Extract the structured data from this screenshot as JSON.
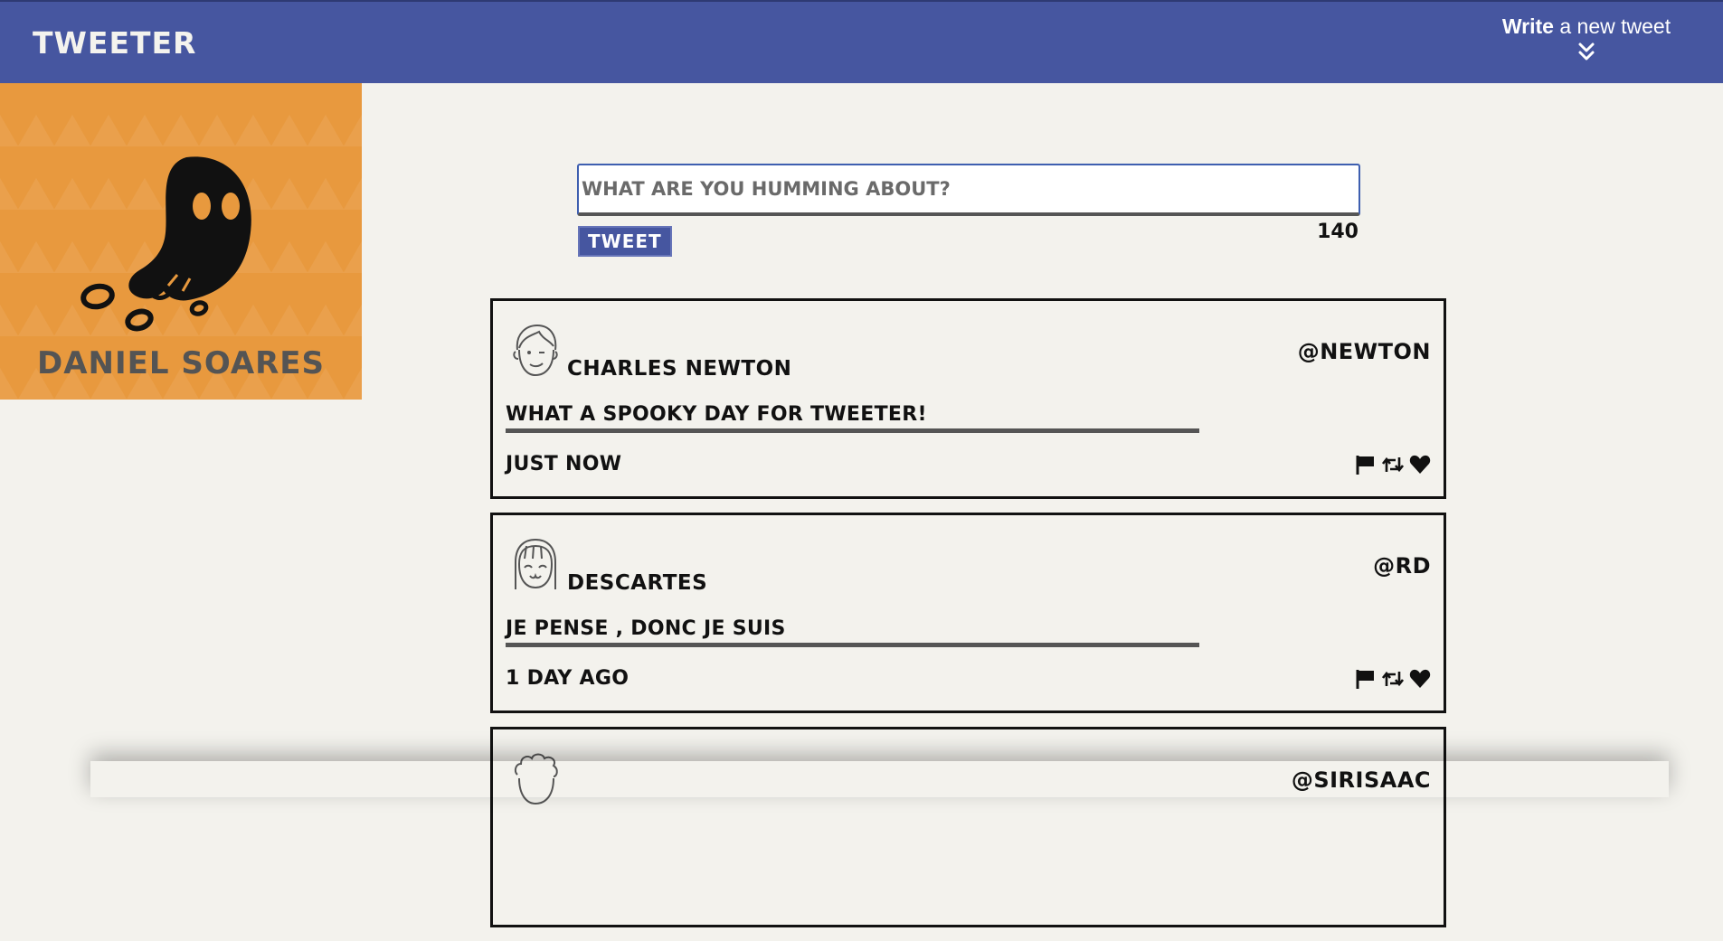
{
  "nav": {
    "brand": "TWEETER",
    "compose_bold": "Write",
    "compose_rest": " a new tweet",
    "compose_icon": "double-chevron-down-icon"
  },
  "profile": {
    "name": "DANIEL SOARES",
    "icon": "ghost-icon",
    "background_color": "#e8993e"
  },
  "composer": {
    "placeholder": "WHAT ARE YOU HUMMING ABOUT?",
    "value": "",
    "button_label": "TWEET",
    "char_count": "140"
  },
  "tweets": [
    {
      "name": "CHARLES NEWTON",
      "handle": "@NEWTON",
      "content": "WHAT A SPOOKY DAY FOR TWEETER!",
      "time": "JUST NOW",
      "avatar": "boy-face-icon"
    },
    {
      "name": "DESCARTES",
      "handle": "@RD",
      "content": "JE PENSE , DONC JE SUIS",
      "time": "1 DAY AGO",
      "avatar": "girl-face-icon"
    },
    {
      "name": "",
      "handle": "@SIRISAAC",
      "content": "",
      "time": "",
      "avatar": "curly-hair-face-icon"
    }
  ],
  "actions": [
    "flag-icon",
    "retweet-icon",
    "heart-icon"
  ],
  "colors": {
    "nav": "#4656a0",
    "page_bg": "#f3f2ed",
    "profile_bg": "#e8993e",
    "text": "#111111"
  }
}
